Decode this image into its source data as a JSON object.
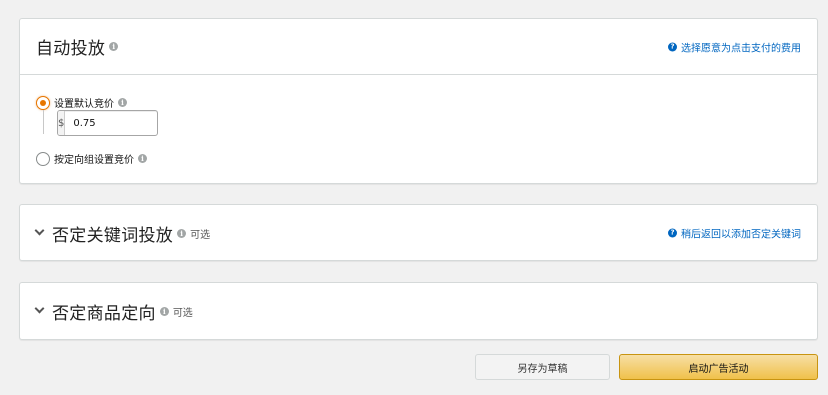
{
  "auto_targeting": {
    "title": "自动投放",
    "help_link": "选择愿意为点击支付的费用",
    "options": [
      {
        "label": "设置默认竞价",
        "selected": true
      },
      {
        "label": "按定向组设置竞价",
        "selected": false
      }
    ],
    "bid": {
      "currency": "$",
      "value": "0.75"
    }
  },
  "negative_keywords": {
    "title": "否定关键词投放",
    "optional": "可选",
    "help_link": "稍后返回以添加否定关键词"
  },
  "negative_products": {
    "title": "否定商品定向",
    "optional": "可选"
  },
  "actions": {
    "save_draft": "另存为草稿",
    "launch": "启动广告活动"
  },
  "colors": {
    "accent": "#e77600",
    "link": "#0066c0",
    "primary_button": "#f0c14b"
  },
  "icons": {
    "info": "info-icon",
    "help": "help-icon",
    "chevron": "chevron-down-icon"
  }
}
